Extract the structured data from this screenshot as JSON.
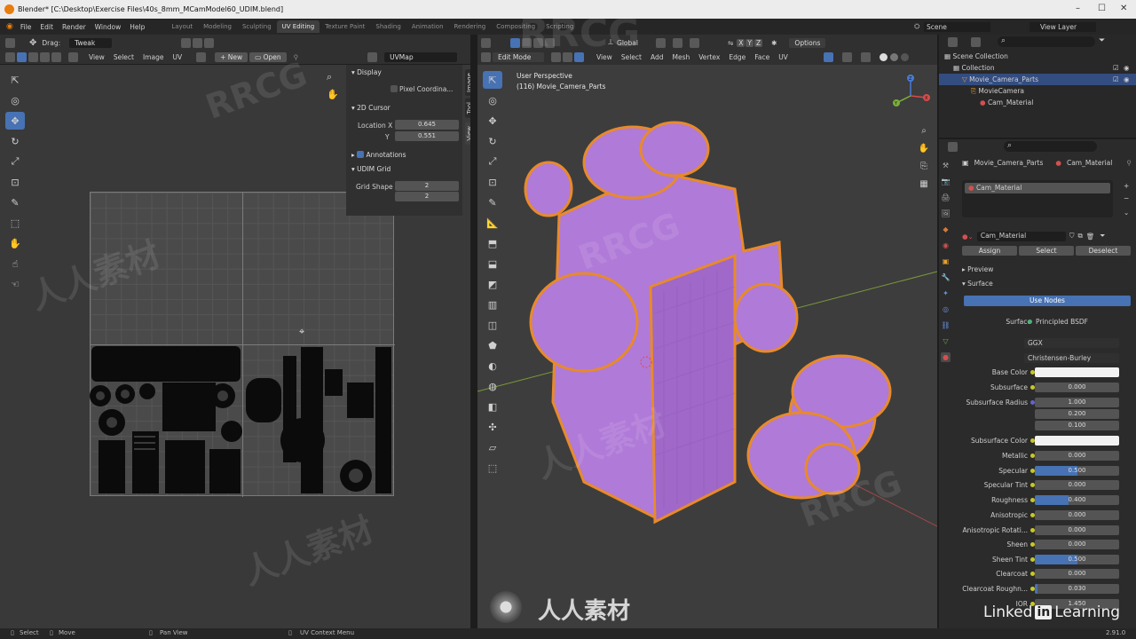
{
  "window": {
    "title": "Blender* [C:\\Desktop\\Exercise Files\\40s_8mm_MCamModel60_UDIM.blend]"
  },
  "topbar": {
    "menus": [
      "File",
      "Edit",
      "Render",
      "Window",
      "Help"
    ],
    "workspaces": [
      "Layout",
      "Modeling",
      "Sculpting",
      "UV Editing",
      "Texture Paint",
      "Shading",
      "Animation",
      "Rendering",
      "Compositing",
      "Scripting"
    ],
    "active_workspace": "UV Editing",
    "scene": "Scene",
    "view_layer": "View Layer"
  },
  "uv_editor": {
    "drag_label": "Drag:",
    "drag_value": "Tweak",
    "menus": [
      "View",
      "Select",
      "Image",
      "UV"
    ],
    "new_label": "New",
    "open_label": "Open",
    "uvmap": "UVMap",
    "sidebar": {
      "display": "Display",
      "pixel_coords": "Pixel Coordina...",
      "cursor_2d": "2D Cursor",
      "location_x_label": "Location X",
      "location_x": "0.645",
      "y_label": "Y",
      "location_y": "0.551",
      "annotations": "Annotations",
      "udim_grid": "UDIM Grid",
      "grid_shape_label": "Grid Shape",
      "grid_shape_x": "2",
      "grid_shape_y": "2"
    },
    "tabs": [
      "Image",
      "Tool",
      "View"
    ]
  },
  "viewport": {
    "mode": "Edit Mode",
    "menus": [
      "View",
      "Select",
      "Add",
      "Mesh",
      "Vertex",
      "Edge",
      "Face",
      "UV"
    ],
    "orientation": "Global",
    "options": "Options",
    "overlay_title": "User Perspective",
    "overlay_object": "(116) Movie_Camera_Parts",
    "axes": {
      "x": "X",
      "y": "Y",
      "z": "Z"
    },
    "gizmo_axes": {
      "x": "X",
      "y": "Y",
      "z": "Z"
    }
  },
  "outliner": {
    "items": [
      {
        "label": "Scene Collection"
      },
      {
        "label": "Collection"
      },
      {
        "label": "Movie_Camera_Parts"
      },
      {
        "label": "MovieCamera"
      },
      {
        "label": "Cam_Material"
      }
    ]
  },
  "properties": {
    "object": "Movie_Camera_Parts",
    "material": "Cam_Material",
    "slot": "Cam_Material",
    "material_name": "Cam_Material",
    "assign": "Assign",
    "select": "Select",
    "deselect": "Deselect",
    "preview": "Preview",
    "surface_panel": "Surface",
    "use_nodes": "Use Nodes",
    "surface_label": "Surface",
    "surface_value": "Principled BSDF",
    "distribution": "GGX",
    "subsurface_method": "Christensen-Burley",
    "rows": [
      {
        "label": "Base Color",
        "value": "",
        "kind": "color",
        "color": "#f2f2f2",
        "fill": 0
      },
      {
        "label": "Subsurface",
        "value": "0.000",
        "kind": "num",
        "fill": 0
      },
      {
        "label": "Subsurface Radius",
        "value": "1.000",
        "kind": "num",
        "fill": 0
      },
      {
        "label": "",
        "value": "0.200",
        "kind": "num",
        "fill": 0
      },
      {
        "label": "",
        "value": "0.100",
        "kind": "num",
        "fill": 0
      },
      {
        "label": "Subsurface Color",
        "value": "",
        "kind": "color",
        "color": "#f2f2f2",
        "fill": 0
      },
      {
        "label": "Metallic",
        "value": "0.000",
        "kind": "num",
        "fill": 0
      },
      {
        "label": "Specular",
        "value": "0.500",
        "kind": "num",
        "fill": 0.5
      },
      {
        "label": "Specular Tint",
        "value": "0.000",
        "kind": "num",
        "fill": 0
      },
      {
        "label": "Roughness",
        "value": "0.400",
        "kind": "num",
        "fill": 0.4
      },
      {
        "label": "Anisotropic",
        "value": "0.000",
        "kind": "num",
        "fill": 0
      },
      {
        "label": "Anisotropic Rotati...",
        "value": "0.000",
        "kind": "num",
        "fill": 0
      },
      {
        "label": "Sheen",
        "value": "0.000",
        "kind": "num",
        "fill": 0
      },
      {
        "label": "Sheen Tint",
        "value": "0.500",
        "kind": "num",
        "fill": 0.5
      },
      {
        "label": "Clearcoat",
        "value": "0.000",
        "kind": "num",
        "fill": 0
      },
      {
        "label": "Clearcoat Roughn...",
        "value": "0.030",
        "kind": "num",
        "fill": 0.03
      },
      {
        "label": "IOR",
        "value": "1.450",
        "kind": "num",
        "fill": 0
      }
    ]
  },
  "statusbar": {
    "select": "Select",
    "move": "Move",
    "pan_view": "Pan View",
    "uv_context": "UV Context Menu",
    "version": "2.91.0"
  },
  "watermarks": {
    "rrcg": "RRCG",
    "cn": "人人素材",
    "linkedin": "Linked",
    "in": "in",
    "learning": "Learning"
  },
  "colors": {
    "accent": "#4772b3",
    "mesh": "#b07ad8",
    "edge": "#e88a2a",
    "header": "#303030"
  }
}
